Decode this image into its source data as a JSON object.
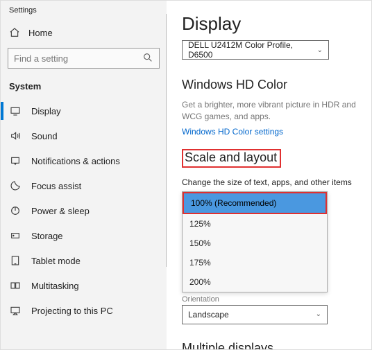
{
  "window_title": "Settings",
  "home_label": "Home",
  "search": {
    "placeholder": "Find a setting"
  },
  "section_label": "System",
  "nav": {
    "items": [
      {
        "label": "Display"
      },
      {
        "label": "Sound"
      },
      {
        "label": "Notifications & actions"
      },
      {
        "label": "Focus assist"
      },
      {
        "label": "Power & sleep"
      },
      {
        "label": "Storage"
      },
      {
        "label": "Tablet mode"
      },
      {
        "label": "Multitasking"
      },
      {
        "label": "Projecting to this PC"
      }
    ]
  },
  "main": {
    "title": "Display",
    "color_profile_selected": "DELL U2412M Color Profile, D6500",
    "hd_heading": "Windows HD Color",
    "hd_desc": "Get a brighter, more vibrant picture in HDR and WCG games, and apps.",
    "hd_link": "Windows HD Color settings",
    "scale_heading": "Scale and layout",
    "scale_label": "Change the size of text, apps, and other items",
    "scale_options": [
      "100% (Recommended)",
      "125%",
      "150%",
      "175%",
      "200%"
    ],
    "orientation_label": "Orientation",
    "orientation_selected": "Landscape",
    "multiple_heading": "Multiple displays"
  }
}
